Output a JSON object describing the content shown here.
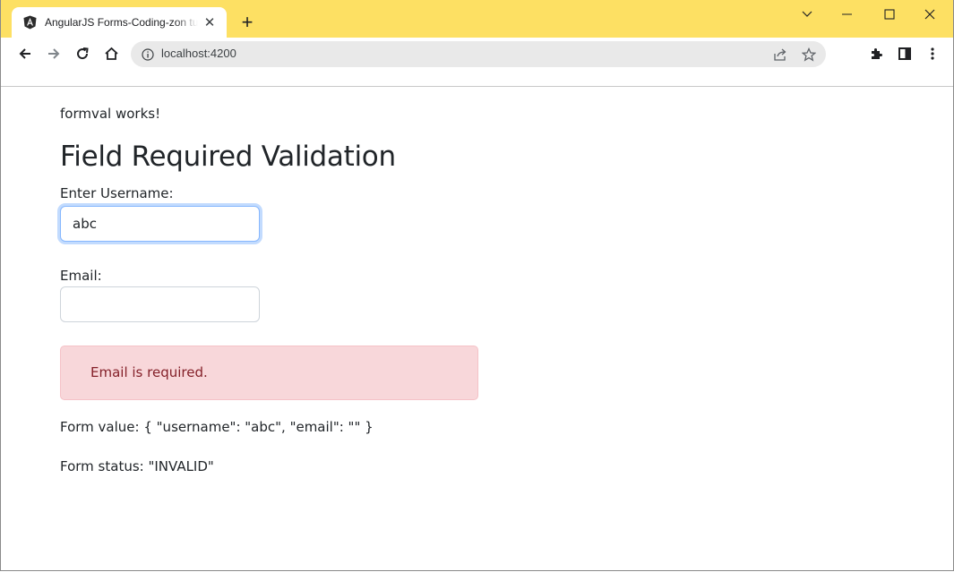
{
  "browser": {
    "tab_title": "AngularJS Forms-Coding-zon tutorial",
    "url": "localhost:4200",
    "tab_close_glyph": "✕",
    "new_tab_glyph": "+",
    "accent_color": "#fde063"
  },
  "icons": [
    "angular-favicon-icon",
    "back-icon",
    "forward-icon",
    "reload-icon",
    "home-icon",
    "site-info-icon",
    "share-icon",
    "star-icon",
    "extensions-icon",
    "side-panel-icon",
    "menu-icon",
    "chevron-down-icon",
    "minimize-icon",
    "maximize-icon",
    "close-icon"
  ],
  "page": {
    "component_text": "formval works!",
    "heading": "Field Required Validation",
    "username": {
      "label": "Enter Username:",
      "value": "abc"
    },
    "email": {
      "label": "Email:",
      "value": ""
    },
    "error_message": "Email is required.",
    "form_value": "Form value: { \"username\": \"abc\", \"email\": \"\" }",
    "form_status": "Form status: \"INVALID\""
  },
  "colors": {
    "alert_bg": "#f8d7da",
    "alert_text": "#842029",
    "focus_border": "#86b7fe"
  }
}
